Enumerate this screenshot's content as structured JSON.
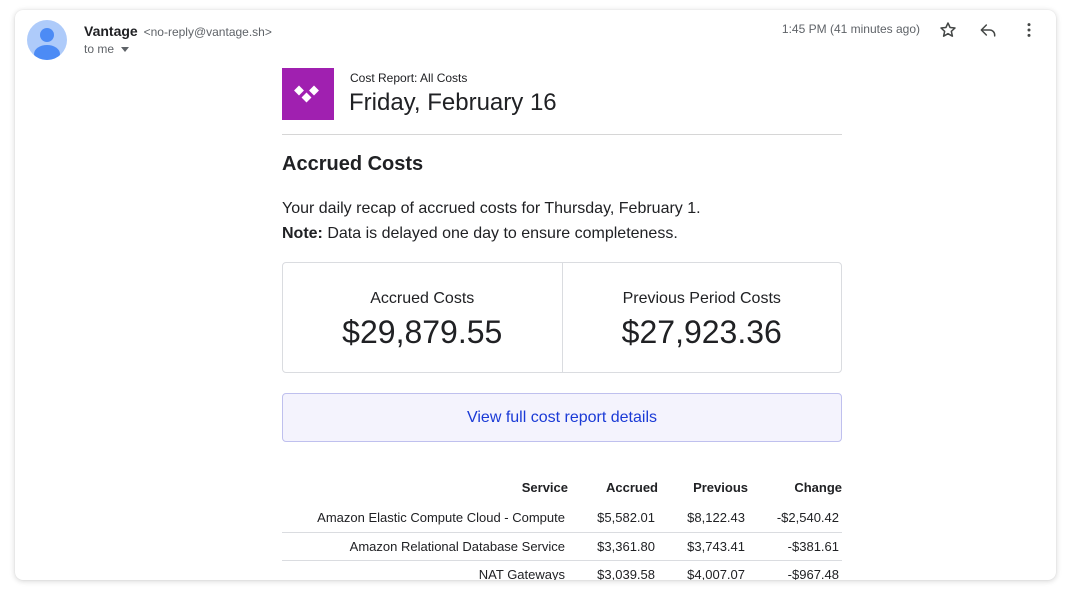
{
  "header": {
    "sender_name": "Vantage",
    "sender_email": "<no-reply@vantage.sh>",
    "to_label": "to me",
    "timestamp": "1:45 PM (41 minutes ago)"
  },
  "report": {
    "label": "Cost Report: All Costs",
    "date": "Friday, February 16",
    "section_title": "Accrued Costs",
    "recap_text": "Your daily recap of accrued costs for Thursday, February 1.",
    "note_label": "Note:",
    "note_text": " Data is delayed one day to ensure completeness."
  },
  "metrics": [
    {
      "label": "Accrued Costs",
      "value": "$29,879.55"
    },
    {
      "label": "Previous Period Costs",
      "value": "$27,923.36"
    }
  ],
  "cta_label": "View full cost report details",
  "table": {
    "headers": [
      "Service",
      "Accrued",
      "Previous",
      "Change"
    ],
    "rows": [
      [
        "Amazon Elastic Compute Cloud - Compute",
        "$5,582.01",
        "$8,122.43",
        "-$2,540.42"
      ],
      [
        "Amazon Relational Database Service",
        "$3,361.80",
        "$3,743.41",
        "-$381.61"
      ],
      [
        "NAT Gateways",
        "$3,039.58",
        "$4,007.07",
        "-$967.48"
      ]
    ]
  },
  "colors": {
    "brand_logo": "#a020b0",
    "link": "#1a3ad6",
    "cta_background": "#f4f3fd"
  },
  "icons": [
    "avatar-person-icon",
    "caret-down-icon",
    "star-icon",
    "reply-icon",
    "more-vert-icon",
    "vantage-logo-icon"
  ]
}
